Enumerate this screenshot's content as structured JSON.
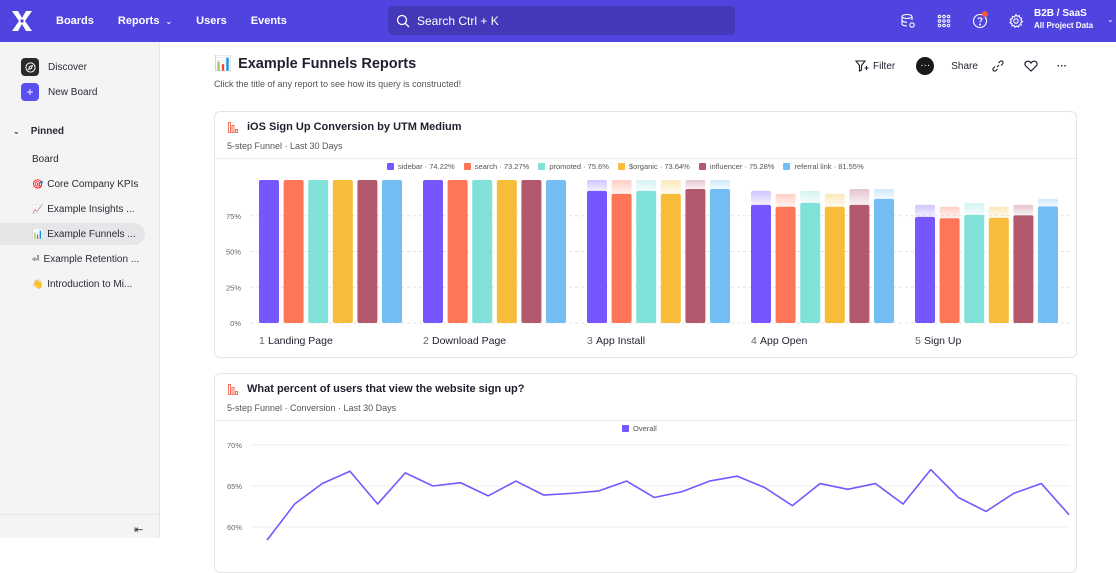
{
  "topbar": {
    "nav": [
      {
        "label": "Boards",
        "has_dropdown": false
      },
      {
        "label": "Reports",
        "has_dropdown": true
      },
      {
        "label": "Users",
        "has_dropdown": false
      },
      {
        "label": "Events",
        "has_dropdown": false
      }
    ],
    "search_placeholder": "Search",
    "search_shortcut": "Ctrl + K",
    "icons": [
      "data-settings-icon",
      "apps-grid-icon",
      "help-icon",
      "gear-icon"
    ],
    "project_name": "B2B / SaaS",
    "project_scope": "All Project Data"
  },
  "sidebar": {
    "discover_label": "Discover",
    "new_board_label": "New Board",
    "pinned_label": "Pinned",
    "items": [
      {
        "emoji": "",
        "label": "Board",
        "active": false
      },
      {
        "emoji": "🎯",
        "label": "Core Company KPIs",
        "active": false
      },
      {
        "emoji": "📈",
        "label": "Example Insights ...",
        "active": false
      },
      {
        "emoji": "📊",
        "label": "Example Funnels ...",
        "active": true
      },
      {
        "emoji": "⏎",
        "label": "Example Retention ...",
        "active": false
      },
      {
        "emoji": "👋",
        "label": "Introduction to Mi...",
        "active": false
      }
    ]
  },
  "page": {
    "emoji": "📊",
    "title": "Example Funnels Reports",
    "description": "Click the title of any report to see how its query is constructed!",
    "actions": {
      "filter": "Filter",
      "share": "Share"
    }
  },
  "colors": {
    "brand": "#4f44e0",
    "series": [
      "#7856ff",
      "#ff7557",
      "#80e1d9",
      "#f8bc3b",
      "#b2596e",
      "#72bef4"
    ]
  },
  "reports": [
    {
      "title": "iOS Sign Up Conversion by UTM Medium",
      "subtitle": "5-step Funnel · Last 30 Days"
    },
    {
      "title": "What percent of users that view the website sign up?",
      "subtitle": "5-step Funnel · Conversion · Last 30 Days"
    }
  ],
  "chart_data": [
    {
      "type": "bar",
      "title": "iOS Sign Up Conversion by UTM Medium",
      "categories": [
        "Landing Page",
        "Download Page",
        "App Install",
        "App Open",
        "Sign Up"
      ],
      "step_numbers": [
        "1",
        "2",
        "3",
        "4",
        "5"
      ],
      "yticks": [
        "0%",
        "25%",
        "50%",
        "75%"
      ],
      "ylim": [
        0,
        100
      ],
      "legend_position": "top-center",
      "series": [
        {
          "name": "sidebar",
          "legend": "sidebar · 74.22%",
          "values": [
            100,
            100,
            92.4,
            82.6,
            74.22
          ]
        },
        {
          "name": "search",
          "legend": "search · 73.27%",
          "values": [
            100,
            100,
            90.3,
            81.3,
            73.27
          ]
        },
        {
          "name": "promoted",
          "legend": "promoted · 75.6%",
          "values": [
            100,
            100,
            92.4,
            84.0,
            75.6
          ]
        },
        {
          "name": "$organic",
          "legend": "$organic · 73.64%",
          "values": [
            100,
            100,
            90.3,
            81.3,
            73.64
          ]
        },
        {
          "name": "influencer",
          "legend": "influencer · 75.28%",
          "values": [
            100,
            100,
            93.7,
            82.6,
            75.28
          ]
        },
        {
          "name": "referral link",
          "legend": "referral link · 81.55%",
          "values": [
            100,
            100,
            93.7,
            86.8,
            81.55
          ]
        }
      ]
    },
    {
      "type": "line",
      "title": "What percent of users that view the website sign up?",
      "yticks": [
        "60%",
        "65%",
        "70%"
      ],
      "ylim": [
        58,
        71
      ],
      "legend_position": "top-center",
      "series": [
        {
          "name": "Overall",
          "values": [
            58.4,
            62.8,
            65.3,
            66.8,
            62.8,
            66.6,
            65.0,
            65.4,
            63.8,
            65.6,
            63.9,
            64.1,
            64.4,
            65.6,
            63.6,
            64.3,
            65.6,
            66.2,
            64.8,
            62.6,
            65.3,
            64.6,
            65.3,
            62.8,
            67.0,
            63.6,
            61.9,
            64.1,
            65.3,
            61.5
          ]
        }
      ]
    }
  ]
}
